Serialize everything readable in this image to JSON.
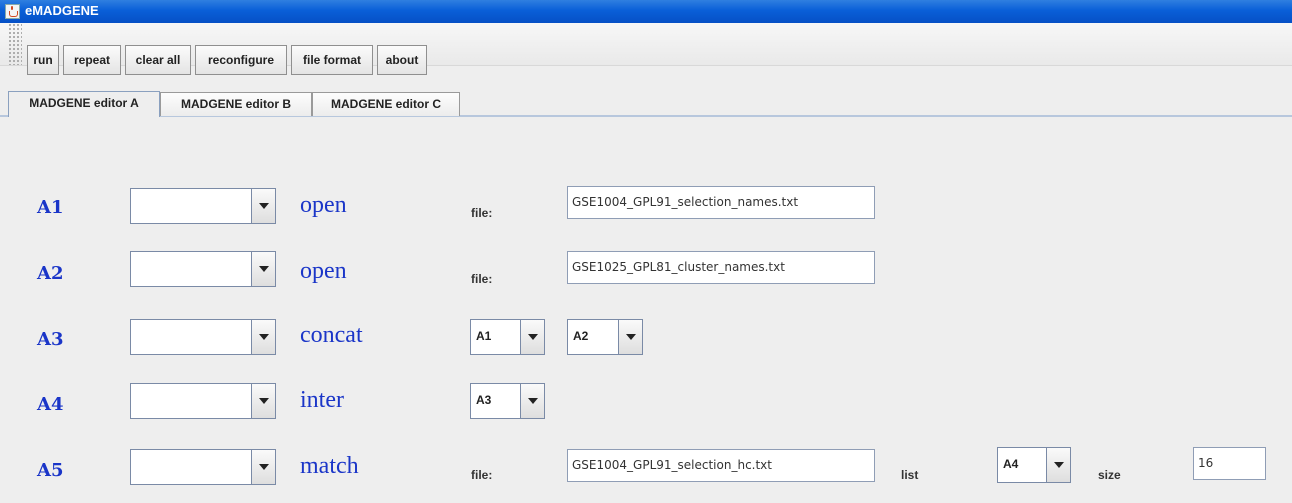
{
  "window": {
    "title": "eMADGENE"
  },
  "toolbar": {
    "buttons": [
      {
        "label": "run"
      },
      {
        "label": "repeat"
      },
      {
        "label": "clear all"
      },
      {
        "label": "reconfigure"
      },
      {
        "label": "file format"
      },
      {
        "label": "about"
      }
    ]
  },
  "tabs": [
    {
      "label": "MADGENE editor A",
      "active": true
    },
    {
      "label": "MADGENE editor B",
      "active": false
    },
    {
      "label": "MADGENE editor C",
      "active": false
    }
  ],
  "editor": {
    "rows": [
      {
        "label": "A1",
        "op": "open",
        "file_label": "file:",
        "file": "GSE1004_GPL91_selection_names.txt"
      },
      {
        "label": "A2",
        "op": "open",
        "file_label": "file:",
        "file": "GSE1025_GPL81_cluster_names.txt"
      },
      {
        "label": "A3",
        "op": "concat",
        "arg1": "A1",
        "arg2": "A2"
      },
      {
        "label": "A4",
        "op": "inter",
        "arg1": "A3"
      },
      {
        "label": "A5",
        "op": "match",
        "file_label": "file:",
        "file": "GSE1004_GPL91_selection_hc.txt",
        "list_label": "list",
        "list_value": "A4",
        "size_label": "size",
        "size_value": "16"
      }
    ]
  },
  "colors": {
    "titlebar": "#0a5fd8",
    "row_label": "#1a35c8"
  }
}
